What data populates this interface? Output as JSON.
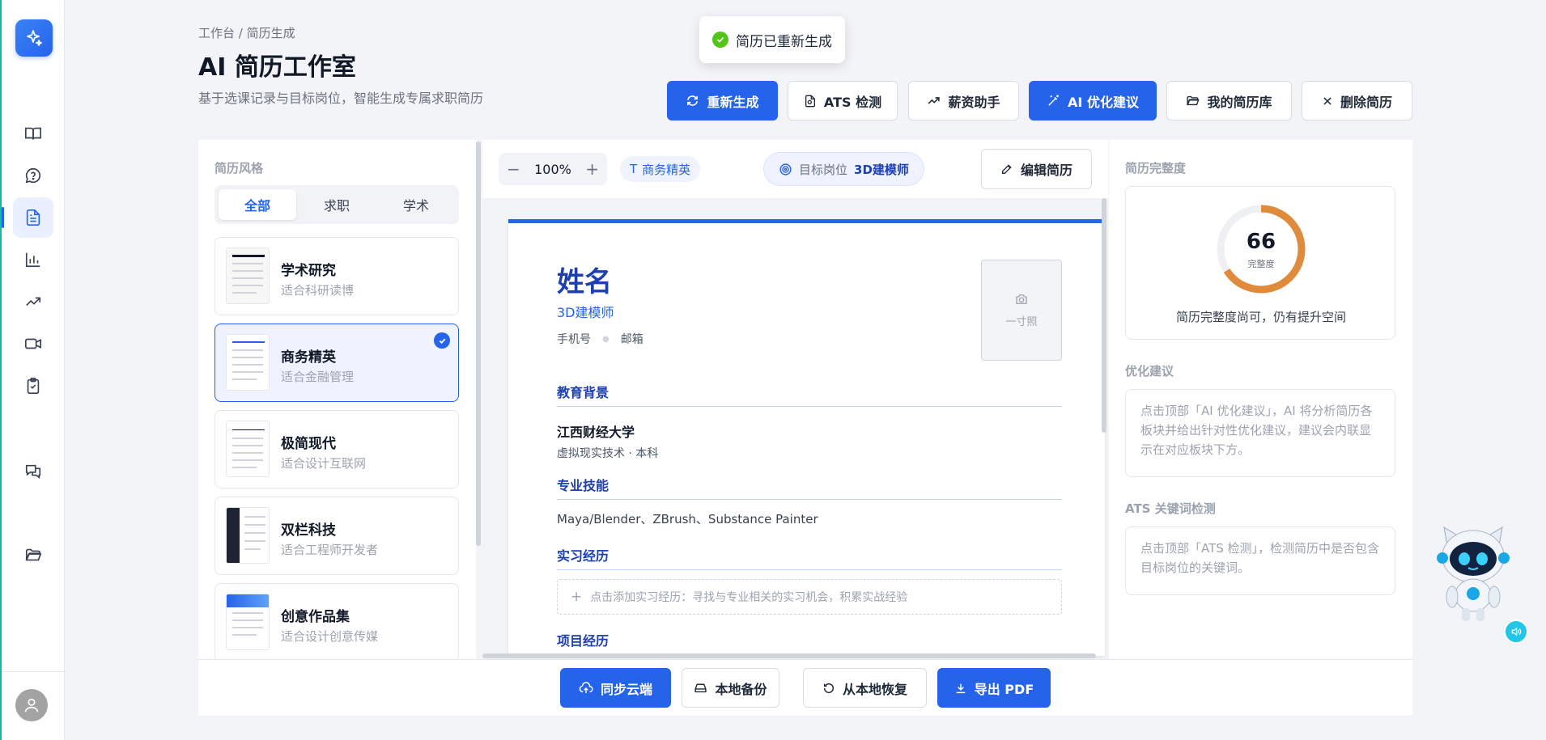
{
  "sidebar": {
    "icons": [
      "sparkles-icon",
      "book-icon",
      "question-icon",
      "resume-icon",
      "bar-chart-icon",
      "trend-icon",
      "video-icon",
      "clipboard-check-icon",
      "chat-icon",
      "folder-icon"
    ],
    "active": "resume-icon"
  },
  "header": {
    "breadcrumb": "工作台 / 简历生成",
    "title": "AI 简历工作室",
    "subtitle": "基于选课记录与目标岗位，智能生成专属求职简历"
  },
  "toast": {
    "message": "简历已重新生成"
  },
  "toolbar": {
    "regenerate": "重新生成",
    "ats": "ATS 检测",
    "salary": "薪资助手",
    "ai_optimize": "AI 优化建议",
    "library": "我的简历库",
    "delete": "删除简历"
  },
  "styles_panel": {
    "label": "简历风格",
    "filters": [
      "全部",
      "求职",
      "学术"
    ],
    "active_filter": "全部",
    "templates": [
      {
        "name": "学术研究",
        "desc": "适合科研读博"
      },
      {
        "name": "商务精英",
        "desc": "适合金融管理",
        "selected": true
      },
      {
        "name": "极简现代",
        "desc": "适合设计互联网"
      },
      {
        "name": "双栏科技",
        "desc": "适合工程师开发者"
      },
      {
        "name": "创意作品集",
        "desc": "适合设计创意传媒"
      }
    ]
  },
  "preview": {
    "zoom": "100%",
    "template_chip": "商务精英",
    "target_label": "目标岗位",
    "target_value": "3D建模师",
    "edit_button": "编辑简历"
  },
  "resume": {
    "name": "姓名",
    "role": "3D建模师",
    "phone": "手机号",
    "email": "邮箱",
    "photo": "一寸照",
    "education_title": "教育背景",
    "school": "江西财经大学",
    "major_line": "虚拟现实技术 · 本科",
    "skills_title": "专业技能",
    "skills": "Maya/Blender、ZBrush、Substance Painter",
    "internship_title": "实习经历",
    "internship_add": "点击添加实习经历：寻找与专业相关的实习机会，积累实战经验",
    "project_title": "项目经历"
  },
  "right_panel": {
    "completeness_label": "简历完整度",
    "score": "66",
    "score_caption": "完整度",
    "score_value": 0.66,
    "completeness_hint": "简历完整度尚可，仍有提升空间",
    "suggest_label": "优化建议",
    "suggest_hint": "点击顶部「AI 优化建议」，AI 将分析简历各板块并给出针对性优化建议，建议会内联显示在对应板块下方。",
    "ats_label": "ATS 关键词检测",
    "ats_hint": "点击顶部「ATS 检测」，检测简历中是否包含目标岗位的关键词。"
  },
  "bottom": {
    "sync": "同步云端",
    "backup": "本地备份",
    "restore": "从本地恢复",
    "export": "导出 PDF"
  },
  "colors": {
    "primary": "#2563eb",
    "success": "#52c41a",
    "ring": "#e08a3c"
  }
}
